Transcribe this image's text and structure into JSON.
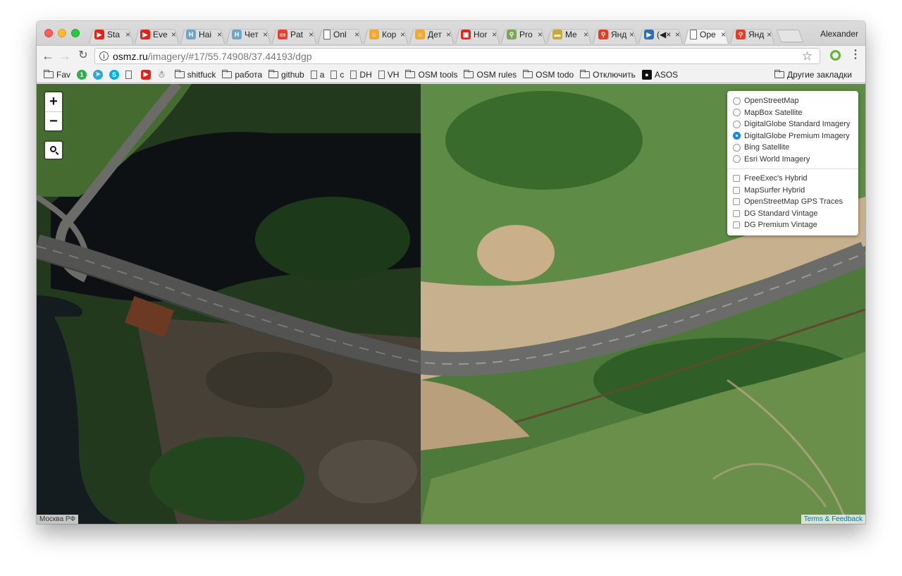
{
  "window": {
    "profile_name": "Alexander",
    "tabs": [
      {
        "title": "Sta",
        "icon": "youtube-icon",
        "color": "#e62117",
        "glyph": "▶",
        "active": false
      },
      {
        "title": "Eve",
        "icon": "youtube-icon",
        "color": "#e62117",
        "glyph": "▶",
        "active": false
      },
      {
        "title": "Hai",
        "icon": "habr-icon",
        "color": "#6fa6c8",
        "glyph": "H",
        "active": false
      },
      {
        "title": "Чет",
        "icon": "habr-icon",
        "color": "#6fa6c8",
        "glyph": "H",
        "active": false
      },
      {
        "title": "Pat",
        "icon": "patreon-icon",
        "color": "#e8402f",
        "glyph": "▭",
        "active": false
      },
      {
        "title": "Onl",
        "icon": "page-icon",
        "color": "#ffffff",
        "glyph": "",
        "active": false
      },
      {
        "title": "Кор",
        "icon": "cat-icon",
        "color": "#f0a830",
        "glyph": "☺",
        "active": false
      },
      {
        "title": "Дет",
        "icon": "cat-icon",
        "color": "#f0a830",
        "glyph": "☺",
        "active": false
      },
      {
        "title": "Hor",
        "icon": "tv-icon",
        "color": "#d92a1c",
        "glyph": "▣",
        "active": false
      },
      {
        "title": "Pro",
        "icon": "wrench-icon",
        "color": "#7aa655",
        "glyph": "⚲",
        "active": false
      },
      {
        "title": "Me",
        "icon": "tape-icon",
        "color": "#c8a838",
        "glyph": "▬",
        "active": false
      },
      {
        "title": "Янд",
        "icon": "yandex-maps-icon",
        "color": "#e73b25",
        "glyph": "⚲",
        "active": false
      },
      {
        "title": "(◀×",
        "icon": "play-icon",
        "color": "#2f6db5",
        "glyph": "▶",
        "active": false
      },
      {
        "title": "Ope",
        "icon": "page-icon",
        "color": "#ffffff",
        "glyph": "",
        "active": true
      },
      {
        "title": "Янд",
        "icon": "yandex-maps-icon",
        "color": "#e73b25",
        "glyph": "⚲",
        "active": false
      }
    ],
    "tab_close": "×"
  },
  "toolbar": {
    "url_host": "osmz.ru",
    "url_path": "/imagery/#17/55.74908/37.44193/dgp"
  },
  "bookmarks": {
    "items": [
      {
        "label": "Fav",
        "type": "folder"
      },
      {
        "label": "",
        "type": "circle",
        "icon": "one-icon",
        "color": "#2bb24c",
        "glyph": "1"
      },
      {
        "label": "",
        "type": "circle",
        "icon": "telegram-icon",
        "color": "#2ca5e0",
        "glyph": "➤"
      },
      {
        "label": "",
        "type": "circle",
        "icon": "skype-icon",
        "color": "#00aff0",
        "glyph": "S"
      },
      {
        "label": "",
        "type": "page",
        "icon": "page-icon"
      },
      {
        "label": "",
        "type": "circle",
        "icon": "youtube-icon",
        "color": "#e62117",
        "glyph": "▶"
      },
      {
        "label": "",
        "type": "glyph",
        "icon": "robot-icon",
        "glyph": "☃"
      },
      {
        "label": "shitfuck",
        "type": "folder"
      },
      {
        "label": "работа",
        "type": "folder"
      },
      {
        "label": "github",
        "type": "folder"
      },
      {
        "label": "a",
        "type": "page"
      },
      {
        "label": "c",
        "type": "page"
      },
      {
        "label": "DH",
        "type": "page"
      },
      {
        "label": "VH",
        "type": "page"
      },
      {
        "label": "OSM tools",
        "type": "folder"
      },
      {
        "label": "OSM rules",
        "type": "folder"
      },
      {
        "label": "OSM todo",
        "type": "folder"
      },
      {
        "label": "Отключить",
        "type": "folder"
      },
      {
        "label": "ASOS",
        "type": "asos"
      }
    ],
    "other_bookmarks": "Другие закладки"
  },
  "map": {
    "zoom_in": "+",
    "zoom_out": "−",
    "base_layers": [
      {
        "label": "OpenStreetMap",
        "checked": false
      },
      {
        "label": "MapBox Satellite",
        "checked": false
      },
      {
        "label": "DigitalGlobe Standard Imagery",
        "checked": false
      },
      {
        "label": "DigitalGlobe Premium Imagery",
        "checked": true
      },
      {
        "label": "Bing Satellite",
        "checked": false
      },
      {
        "label": "Esri World Imagery",
        "checked": false
      }
    ],
    "overlay_layers": [
      {
        "label": "FreeExec's Hybrid",
        "checked": false
      },
      {
        "label": "MapSurfer Hybrid",
        "checked": false
      },
      {
        "label": "OpenStreetMap GPS Traces",
        "checked": false
      },
      {
        "label": "DG Standard Vintage",
        "checked": false
      },
      {
        "label": "DG Premium Vintage",
        "checked": false
      }
    ],
    "attribution_left": "Москва РФ",
    "attribution_right": "Terms & Feedback"
  }
}
